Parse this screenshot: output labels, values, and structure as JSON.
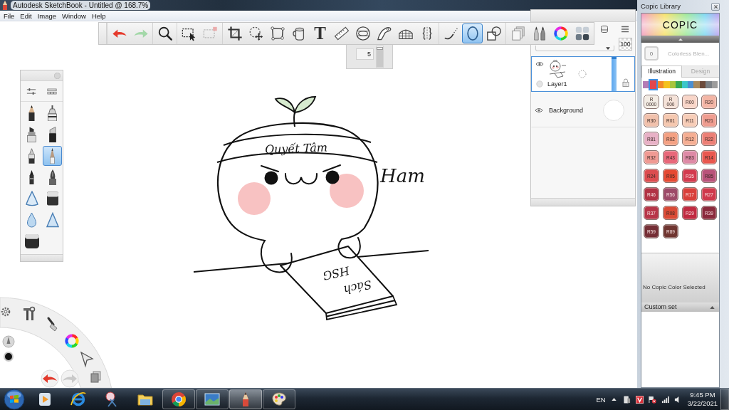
{
  "window": {
    "title": "Autodesk SketchBook - Untitled @ 168.7%"
  },
  "menu": [
    {
      "label": "File"
    },
    {
      "label": "Edit"
    },
    {
      "label": "Image"
    },
    {
      "label": "Window"
    },
    {
      "label": "Help"
    }
  ],
  "toolbar": {
    "groups": [
      [
        {
          "kind": "undo",
          "selected": false,
          "disabled": false
        },
        {
          "kind": "redo",
          "selected": false,
          "disabled": true
        }
      ],
      [
        {
          "kind": "zoom",
          "selected": false,
          "disabled": false
        }
      ],
      [
        {
          "kind": "select",
          "selected": false,
          "disabled": false
        },
        {
          "kind": "select_add",
          "selected": false,
          "disabled": true
        }
      ],
      [
        {
          "kind": "crop",
          "selected": false,
          "disabled": false
        },
        {
          "kind": "transform",
          "selected": false,
          "disabled": false
        },
        {
          "kind": "distort",
          "selected": false,
          "disabled": false
        },
        {
          "kind": "fill",
          "selected": false,
          "disabled": false
        },
        {
          "kind": "text",
          "glyph": "T",
          "selected": false,
          "disabled": false
        },
        {
          "kind": "ruler",
          "selected": false,
          "disabled": false
        },
        {
          "kind": "ellipse_guide",
          "selected": false,
          "disabled": false
        },
        {
          "kind": "french_curve",
          "selected": false,
          "disabled": false
        },
        {
          "kind": "perspective",
          "selected": false,
          "disabled": false
        },
        {
          "kind": "symmetry",
          "selected": false,
          "disabled": false
        }
      ],
      [
        {
          "kind": "stroke",
          "selected": false,
          "disabled": false
        },
        {
          "kind": "ellipse",
          "selected": true,
          "disabled": false
        },
        {
          "kind": "shapes",
          "selected": false,
          "disabled": false
        }
      ],
      [
        {
          "kind": "layers",
          "selected": false,
          "disabled": false
        },
        {
          "kind": "brushes",
          "selected": false,
          "disabled": false
        },
        {
          "kind": "color_wheel",
          "selected": false,
          "disabled": false
        },
        {
          "kind": "copic",
          "selected": false,
          "disabled": false
        }
      ]
    ]
  },
  "brush_size": {
    "value": "5",
    "level": 0.95
  },
  "brush_palette": {
    "brushes": [
      {
        "kind": "pencil",
        "selected": false
      },
      {
        "kind": "technical_pen",
        "selected": false
      },
      {
        "kind": "marker",
        "selected": false
      },
      {
        "kind": "chisel_marker",
        "selected": false
      },
      {
        "kind": "airbrush",
        "selected": false
      },
      {
        "kind": "sharp_pencil",
        "selected": true
      },
      {
        "kind": "brush_pen",
        "selected": false
      },
      {
        "kind": "fountain_pen",
        "selected": false
      },
      {
        "kind": "smear",
        "selected": false
      },
      {
        "kind": "hard_eraser",
        "selected": false
      },
      {
        "kind": "blur",
        "selected": false
      },
      {
        "kind": "sharpen",
        "selected": false
      },
      {
        "kind": "soft_eraser",
        "selected": false
      }
    ]
  },
  "layers": {
    "opacity": "100",
    "items": [
      {
        "kind": "paint",
        "name": "Layer1",
        "visible": true,
        "selected": true
      },
      {
        "kind": "background",
        "name": "Background",
        "visible": true,
        "selected": false
      }
    ]
  },
  "canvas": {
    "headband_text": "Quyết Tâm",
    "side_text": "Ham",
    "book_title": [
      "Sách",
      "HSG"
    ]
  },
  "copic_library": {
    "title": "Copic Library",
    "logo": "COPIC",
    "blender": {
      "code": "0",
      "name": "Colorless Blen..."
    },
    "tabs": [
      {
        "label": "Illustration",
        "selected": true
      },
      {
        "label": "Design",
        "selected": false
      }
    ],
    "families": [
      {
        "color": "#b47cb6",
        "selected": false
      },
      {
        "color": "#e2464d",
        "selected": true
      },
      {
        "color": "#f28a26",
        "selected": false
      },
      {
        "color": "#f4c21c",
        "selected": false
      },
      {
        "color": "#a9c53c",
        "selected": false
      },
      {
        "color": "#35a853",
        "selected": false
      },
      {
        "color": "#3cc6c9",
        "selected": false
      },
      {
        "color": "#4a8fd1",
        "selected": false
      },
      {
        "color": "#a8895c",
        "selected": false
      },
      {
        "color": "#6c4b3b",
        "selected": false
      },
      {
        "color": "#7b8085",
        "selected": false
      },
      {
        "color": "#9c9c9c",
        "selected": false
      }
    ],
    "swatches": [
      {
        "code": "R\n0000",
        "color": "#f3ece4"
      },
      {
        "code": "R\n000",
        "color": "#f5e2d8"
      },
      {
        "code": "R00",
        "color": "#f8d5c8"
      },
      {
        "code": "R20",
        "color": "#f3b5a5"
      },
      {
        "code": "R30",
        "color": "#f1c1ac"
      },
      {
        "code": "R01",
        "color": "#f5c8b0"
      },
      {
        "code": "R11",
        "color": "#f7cdb8"
      },
      {
        "code": "R21",
        "color": "#ef9d90"
      },
      {
        "code": "R81",
        "color": "#e8b1c6"
      },
      {
        "code": "R02",
        "color": "#f4a183"
      },
      {
        "code": "R12",
        "color": "#f5ae93"
      },
      {
        "code": "R22",
        "color": "#ec7f75"
      },
      {
        "code": "R32",
        "color": "#f09a93"
      },
      {
        "code": "R43",
        "color": "#e8687a"
      },
      {
        "code": "R83",
        "color": "#de8aa6"
      },
      {
        "code": "R14",
        "color": "#e9584f"
      },
      {
        "code": "R24",
        "color": "#dc4c4f"
      },
      {
        "code": "R05",
        "color": "#e54a33"
      },
      {
        "code": "R35",
        "color": "#d33b4e"
      },
      {
        "code": "R85",
        "color": "#b9537a"
      },
      {
        "code": "R46",
        "color": "#b13244"
      },
      {
        "code": "R56",
        "color": "#9d4a68"
      },
      {
        "code": "R17",
        "color": "#d9403a"
      },
      {
        "code": "R27",
        "color": "#cf3a4c"
      },
      {
        "code": "R37",
        "color": "#b73548"
      },
      {
        "code": "R08",
        "color": "#d94a35"
      },
      {
        "code": "R29",
        "color": "#c02a40"
      },
      {
        "code": "R39",
        "color": "#8a2a3c"
      },
      {
        "code": "R59",
        "color": "#742e35"
      },
      {
        "code": "R89",
        "color": "#6f3530"
      }
    ],
    "status": "No Copic Color Selected",
    "custom_set": "Custom set"
  },
  "taskbar": {
    "apps": [
      {
        "kind": "media",
        "running": false,
        "selected": false
      },
      {
        "kind": "ie",
        "running": false,
        "selected": false
      },
      {
        "kind": "snip",
        "running": false,
        "selected": false
      },
      {
        "kind": "folder",
        "running": false,
        "selected": false
      },
      {
        "kind": "chrome",
        "running": true,
        "selected": false
      },
      {
        "kind": "photos",
        "running": true,
        "selected": false
      },
      {
        "kind": "sketchbook",
        "running": true,
        "selected": true
      },
      {
        "kind": "paint",
        "running": true,
        "selected": false
      }
    ],
    "language": "EN",
    "time": "9:45 PM",
    "date": "3/22/2021"
  }
}
